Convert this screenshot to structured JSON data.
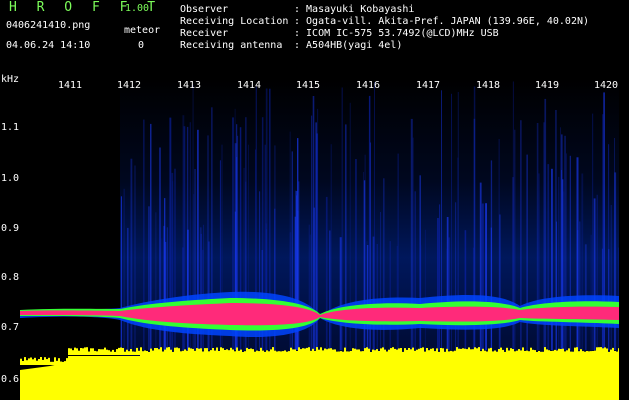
{
  "app": {
    "title": "H R O F F T",
    "version": "1.00"
  },
  "file": "0406241410.png",
  "datetime": "04.06.24 14:10",
  "meteor": {
    "label": "meteor",
    "count": "0"
  },
  "info": [
    {
      "label": "Observer",
      "value": ": Masayuki Kobayashi"
    },
    {
      "label": "Receiving Location",
      "value": ": Ogata-vill. Akita-Pref. JAPAN (139.96E, 40.02N)"
    },
    {
      "label": "Receiver",
      "value": ": ICOM IC-575 53.7492(@LCD)MHz USB"
    },
    {
      "label": "Receiving antenna",
      "value": ": A504HB(yagi 4el)"
    }
  ],
  "axes": {
    "y_unit": "kHz",
    "y_ticks": [
      "1.1",
      "1.0",
      "0.9",
      "0.8",
      "0.7",
      "0.6"
    ],
    "x_ticks": [
      "1411",
      "1412",
      "1413",
      "1414",
      "1415",
      "1416",
      "1417",
      "1418",
      "1419",
      "1420"
    ]
  },
  "colors": {
    "title": "#7cfc5a",
    "band_core": "#ff2a7a",
    "band_mid": "#33ff33",
    "band_edge": "#0044ff",
    "base": "#ffff00"
  }
}
